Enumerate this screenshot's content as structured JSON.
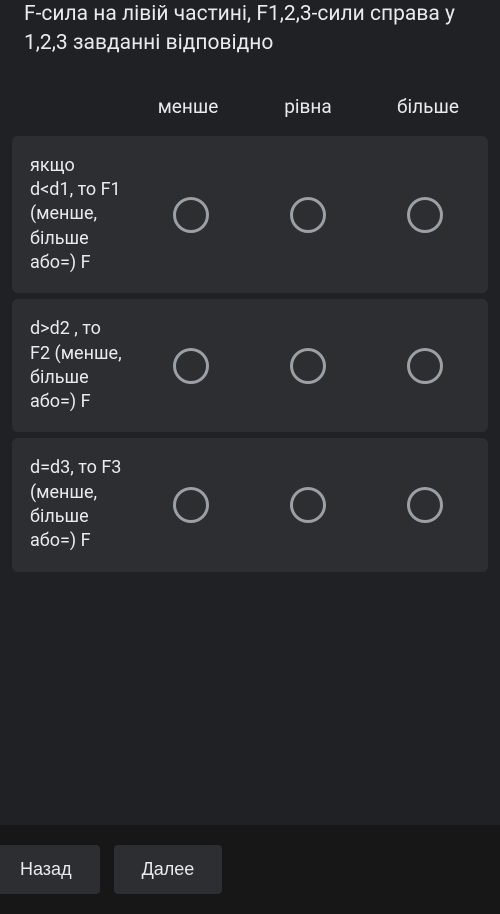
{
  "question": {
    "text_line1": "F-сила на лівій частині, F1,2,3-сили",
    "text_line2": "справа у 1,2,3 завданні відповідно"
  },
  "columns": [
    {
      "label": "менше"
    },
    {
      "label": "рівна"
    },
    {
      "label": "більше"
    }
  ],
  "rows": [
    {
      "label": "якщо d<d1, то F1 (менше, більше або=) F"
    },
    {
      "label": "d>d2 , то F2 (менше, більше або=) F"
    },
    {
      "label": "d=d3, то F3 (менше, більше або=) F"
    }
  ],
  "nav": {
    "back": "Назад",
    "next": "Далее"
  }
}
